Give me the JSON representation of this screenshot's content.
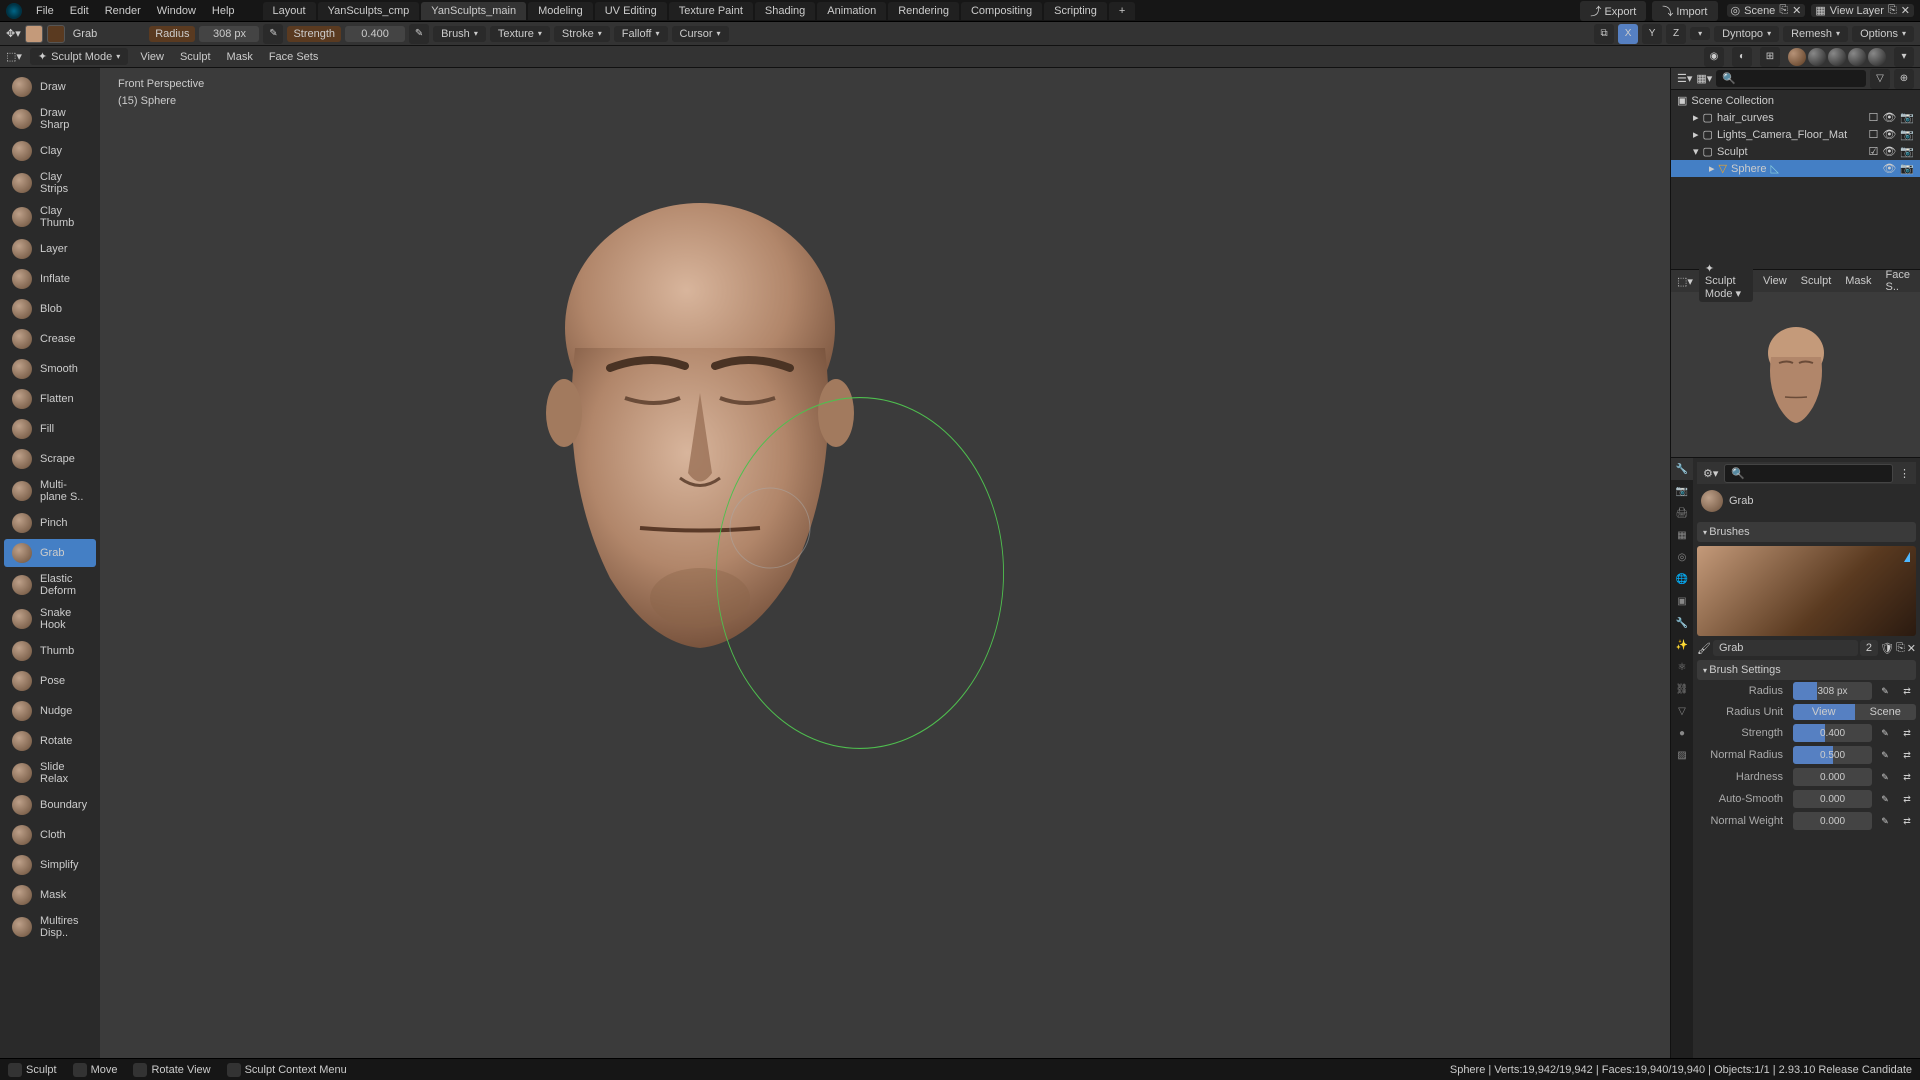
{
  "menubar": {
    "menus": [
      "File",
      "Edit",
      "Render",
      "Window",
      "Help"
    ],
    "workspaces": [
      "Layout",
      "YanSculpts_cmp",
      "YanSculpts_main",
      "Modeling",
      "UV Editing",
      "Texture Paint",
      "Shading",
      "Animation",
      "Rendering",
      "Compositing",
      "Scripting"
    ],
    "active_workspace": 2,
    "export": "Export",
    "import": "Import",
    "scene": "Scene",
    "view_layer": "View Layer"
  },
  "toolheader": {
    "brush_label": "Grab",
    "radius_label": "Radius",
    "radius_value": "308 px",
    "strength_label": "Strength",
    "strength_value": "0.400",
    "dropdowns": [
      "Brush",
      "Texture",
      "Stroke",
      "Falloff",
      "Cursor"
    ],
    "right_dd": [
      "Dyntopo",
      "Remesh",
      "Options"
    ],
    "axes": [
      "X",
      "Y",
      "Z"
    ]
  },
  "viewheader": {
    "mode": "Sculpt Mode",
    "menus": [
      "View",
      "Sculpt",
      "Mask",
      "Face Sets"
    ]
  },
  "viewport": {
    "orientation": "Front Perspective",
    "active_object": "(15) Sphere"
  },
  "brushes": [
    "Draw",
    "Draw Sharp",
    "Clay",
    "Clay Strips",
    "Clay Thumb",
    "Layer",
    "Inflate",
    "Blob",
    "Crease",
    "Smooth",
    "Flatten",
    "Fill",
    "Scrape",
    "Multi-plane S..",
    "Pinch",
    "Grab",
    "Elastic Deform",
    "Snake Hook",
    "Thumb",
    "Pose",
    "Nudge",
    "Rotate",
    "Slide Relax",
    "Boundary",
    "Cloth",
    "Simplify",
    "Mask",
    "Multires Disp.."
  ],
  "active_brush_index": 15,
  "outliner": {
    "root": "Scene Collection",
    "items": [
      {
        "name": "hair_curves",
        "indent": 1
      },
      {
        "name": "Lights_Camera_Floor_Mat",
        "indent": 1
      },
      {
        "name": "Sculpt",
        "indent": 1,
        "expanded": true
      },
      {
        "name": "Sphere",
        "indent": 2,
        "active": true
      }
    ]
  },
  "sculpt2": {
    "mode": "Sculpt Mode",
    "menus": [
      "View",
      "Sculpt",
      "Mask",
      "Face S.."
    ]
  },
  "properties": {
    "brush_name": "Grab",
    "brushes_section": "Brushes",
    "brush_id": "Grab",
    "brush_users": "2",
    "settings_section": "Brush Settings",
    "settings": [
      {
        "label": "Radius",
        "value": "308 px",
        "fill": 30,
        "type": "slider"
      },
      {
        "label": "Radius Unit",
        "type": "toggle",
        "options": [
          "View",
          "Scene"
        ],
        "active": 0
      },
      {
        "label": "Strength",
        "value": "0.400",
        "fill": 40,
        "type": "slider"
      },
      {
        "label": "Normal Radius",
        "value": "0.500",
        "fill": 50,
        "type": "slider"
      },
      {
        "label": "Hardness",
        "value": "0.000",
        "fill": 0,
        "type": "slider"
      },
      {
        "label": "Auto-Smooth",
        "value": "0.000",
        "fill": 0,
        "type": "slider"
      },
      {
        "label": "Normal Weight",
        "value": "0.000",
        "fill": 0,
        "type": "slider"
      }
    ]
  },
  "statusbar": {
    "hints": [
      "Sculpt",
      "Move",
      "Rotate View",
      "Sculpt Context Menu"
    ],
    "stats": "Sphere | Verts:19,942/19,942 | Faces:19,940/19,940 | Objects:1/1 | 2.93.10 Release Candidate"
  }
}
